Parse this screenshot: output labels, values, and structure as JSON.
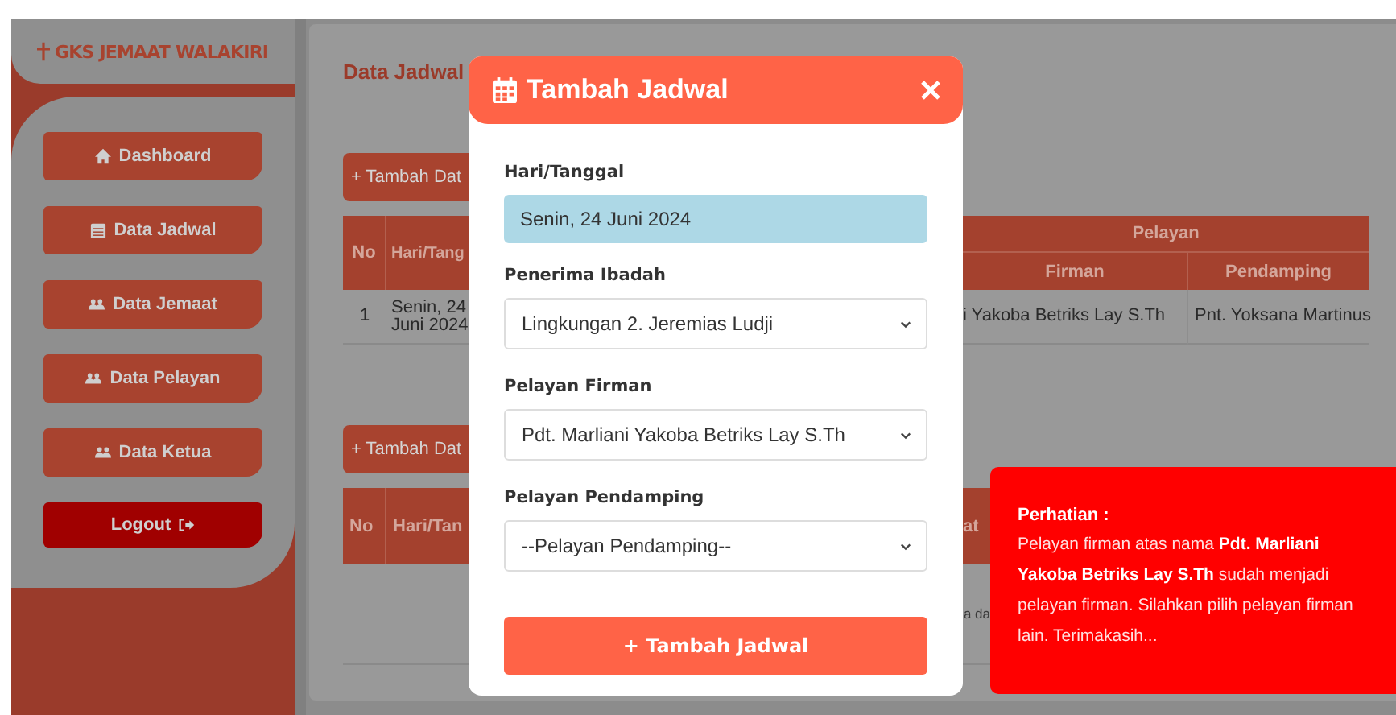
{
  "sidebar": {
    "brand": "GKS JEMAAT WALAKIRI",
    "items": [
      {
        "label": "Dashboard",
        "kind": "nav"
      },
      {
        "label": "Data Jadwal",
        "kind": "nav"
      },
      {
        "label": "Data Jemaat",
        "kind": "nav"
      },
      {
        "label": "Data Pelayan",
        "kind": "nav"
      },
      {
        "label": "Data Ketua",
        "kind": "nav"
      },
      {
        "label": "Logout",
        "kind": "logout"
      }
    ]
  },
  "page": {
    "title": "Data Jadwal"
  },
  "tables": [
    {
      "add_button": "+ Tambah Dat",
      "columns": {
        "no": "No",
        "date": "Hari/Tang",
        "group": "Pelayan",
        "firman": "Firman",
        "pendamping": "Pendamping"
      },
      "rows": [
        {
          "no": "1",
          "date": "Senin, 24 Juni 2024",
          "firman": "i Yakoba Betriks Lay S.Th",
          "pendamping": "Pnt. Yoksana Martinus"
        }
      ]
    },
    {
      "add_button": "+ Tambah Dat",
      "columns": {
        "no": "No",
        "date": "Hari/Tan",
        "column_3": "at"
      },
      "message": "a da"
    }
  ],
  "modal": {
    "title": "Tambah Jadwal",
    "fields": [
      {
        "label": "Hari/Tanggal",
        "kind": "readonly",
        "value": "Senin, 24 Juni 2024"
      },
      {
        "label": "Penerima Ibadah",
        "kind": "select",
        "value": "Lingkungan 2. Jeremias Ludji"
      },
      {
        "label": "Pelayan Firman",
        "kind": "select",
        "value": "Pdt. Marliani Yakoba Betriks Lay S.Th"
      },
      {
        "label": "Pelayan Pendamping",
        "kind": "select",
        "value": "--Pelayan Pendamping--"
      }
    ],
    "submit": "+ Tambah Jadwal"
  },
  "toast": {
    "title": "Perhatian :",
    "message": "Pelayan firman atas nama **Pdt. Marliani Yakoba Betriks Lay S.Th** sudah menjadi pelayan firman. Silahkan pilih pelayan firman lain. Terimakasih..."
  }
}
